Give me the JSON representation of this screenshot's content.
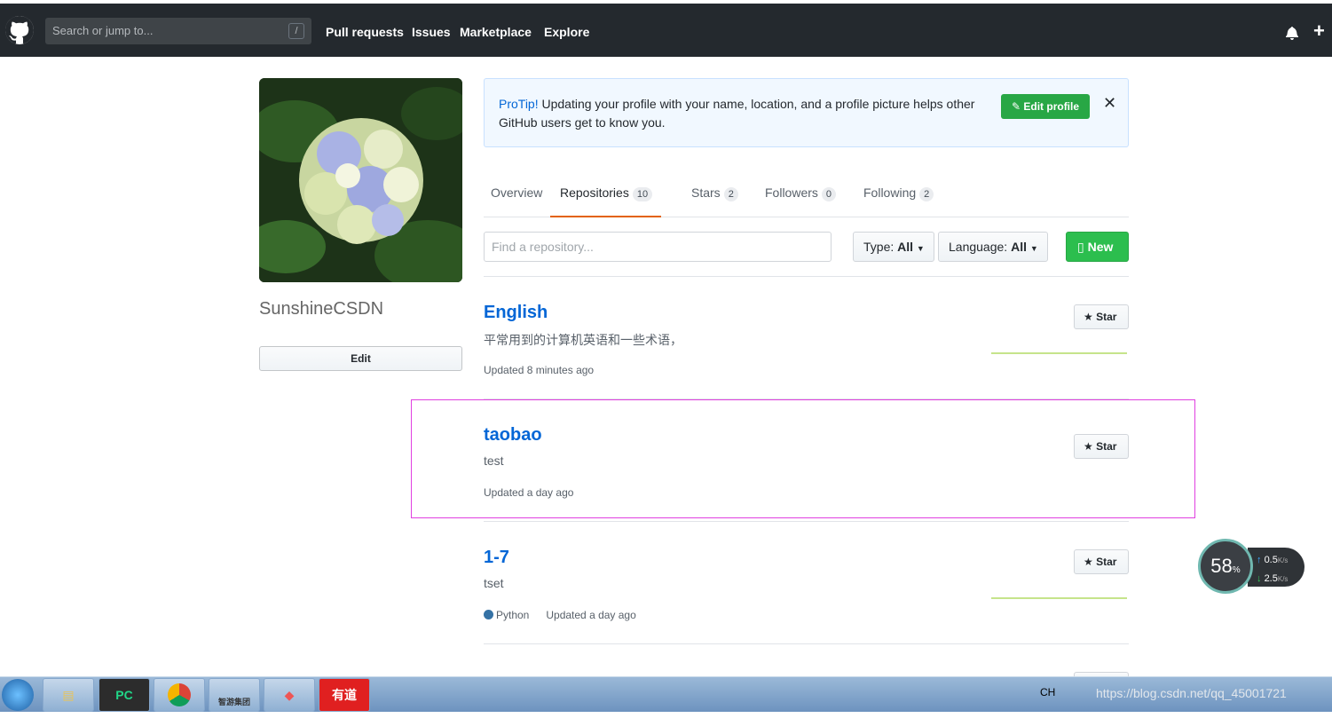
{
  "header": {
    "search_placeholder": "Search or jump to...",
    "search_shortcut": "/",
    "nav": [
      "Pull requests",
      "Issues",
      "Marketplace",
      "Explore"
    ],
    "plus_icon": "+"
  },
  "profile": {
    "username": "SunshineCSDN",
    "edit_label": "Edit"
  },
  "protip": {
    "strong": "ProTip!",
    "text": " Updating your profile with your name, location, and a profile picture helps other GitHub users get to know you.",
    "edit_profile_label": "Edit profile",
    "close_label": "✕"
  },
  "tabs": [
    {
      "label": "Overview",
      "count": ""
    },
    {
      "label": "Repositories",
      "count": "10"
    },
    {
      "label": "Stars",
      "count": "2"
    },
    {
      "label": "Followers",
      "count": "0"
    },
    {
      "label": "Following",
      "count": "2"
    }
  ],
  "filters": {
    "find_placeholder": "Find a repository...",
    "type_label": "Type:",
    "type_value": "All",
    "language_label": "Language:",
    "language_value": "All",
    "new_label": "New"
  },
  "repos": [
    {
      "name": "English",
      "description": "平常用到的计算机英语和一些术语，",
      "language": "",
      "updated": "Updated 8 minutes ago",
      "star_label": "Star"
    },
    {
      "name": "taobao",
      "description": "test",
      "language": "",
      "updated": "Updated a day ago",
      "star_label": "Star"
    },
    {
      "name": "1-7",
      "description": "tset",
      "language": "Python",
      "updated": "Updated a day ago",
      "star_label": "Star"
    }
  ],
  "speed_widget": {
    "percent": "58",
    "percent_unit": "%",
    "up": "0.5",
    "down": "2.5",
    "unit": "K/s"
  },
  "taskbar": {
    "apps": [
      "PC",
      "",
      "",
      "智游集团",
      "",
      "有道"
    ],
    "tray_lang": "CH",
    "tray_overlay": "https://blog.csdn.net/qq_45001721"
  },
  "colors": {
    "accent": "#0366d6",
    "green": "#2cbe4e",
    "active_tab": "#e36209",
    "python": "#3572A5"
  }
}
